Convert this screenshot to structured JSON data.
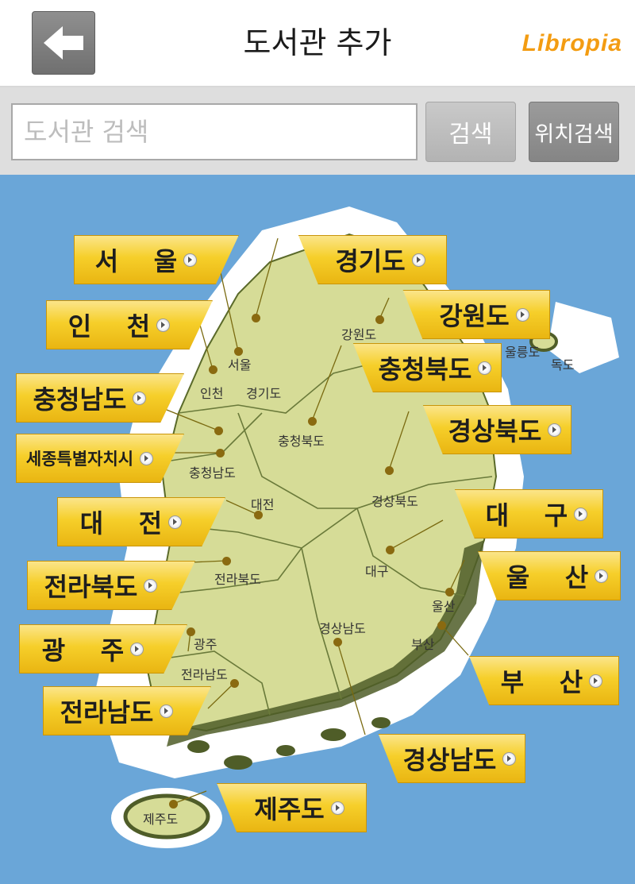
{
  "header": {
    "title": "도서관 추가",
    "logo": "Libropia"
  },
  "search": {
    "placeholder": "도서관 검색",
    "search_label": "검색",
    "location_label": "위치검색"
  },
  "regions": [
    {
      "id": "seoul",
      "label": "서    울"
    },
    {
      "id": "gyeonggi",
      "label": "경기도"
    },
    {
      "id": "incheon",
      "label": "인    천"
    },
    {
      "id": "gangwon",
      "label": "강원도"
    },
    {
      "id": "chungbuk",
      "label": "충청북도"
    },
    {
      "id": "chungnam",
      "label": "충청남도"
    },
    {
      "id": "sejong",
      "label": "세종특별자치시"
    },
    {
      "id": "gyeongbuk",
      "label": "경상북도"
    },
    {
      "id": "daejeon",
      "label": "대    전"
    },
    {
      "id": "daegu",
      "label": "대    구"
    },
    {
      "id": "jeonbuk",
      "label": "전라북도"
    },
    {
      "id": "ulsan",
      "label": "울    산"
    },
    {
      "id": "gwangju",
      "label": "광    주"
    },
    {
      "id": "busan",
      "label": "부    산"
    },
    {
      "id": "jeonnam",
      "label": "전라남도"
    },
    {
      "id": "gyeongnam",
      "label": "경상남도"
    },
    {
      "id": "jeju",
      "label": "제주도"
    }
  ],
  "map_labels": {
    "seoul": "서울",
    "gyeonggi": "경기도",
    "incheon": "인천",
    "gangwon": "강원도",
    "ulleungdo": "울릉도",
    "dokdo": "독도",
    "chungbuk": "충청북도",
    "chungnam": "충청남도",
    "daejeon": "대전",
    "gyeongbuk": "경상북도",
    "daegu": "대구",
    "jeonbuk": "전라북도",
    "ulsan": "울산",
    "busan": "부산",
    "gyeongnam": "경상남도",
    "gwangju": "광주",
    "jeonnam": "전라남도",
    "jeju": "제주도"
  },
  "colors": {
    "sea": "#6aa6d8",
    "land": "#d6dc97",
    "tag": "#f6cf2a",
    "logo": "#f39c12"
  }
}
